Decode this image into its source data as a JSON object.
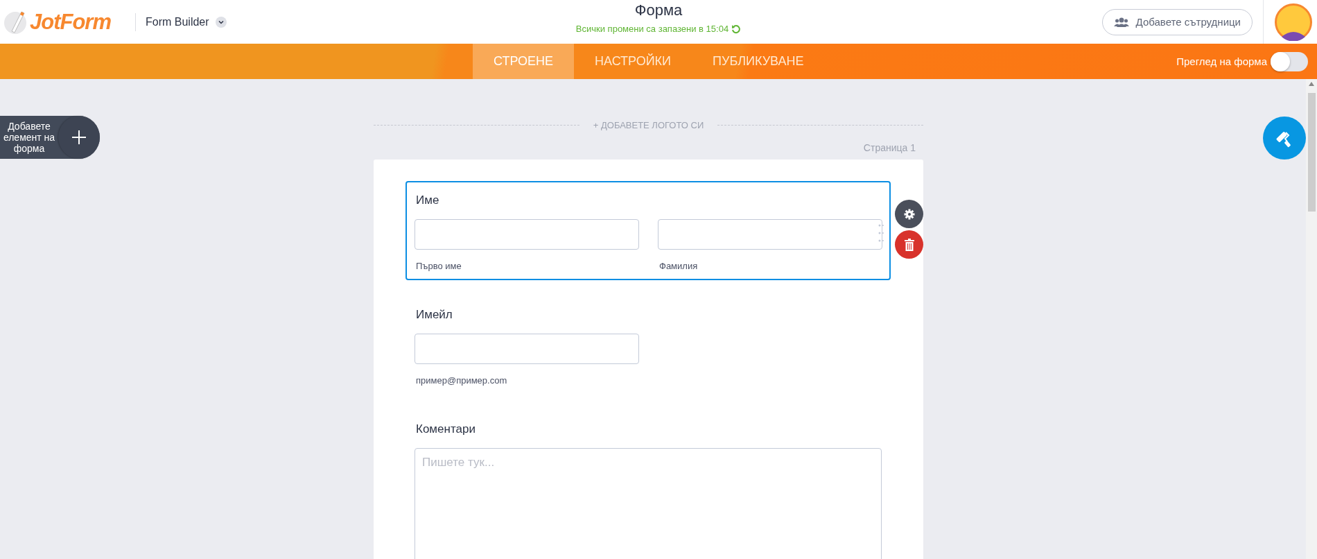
{
  "header": {
    "logo": "JotForm",
    "app_menu": "Form Builder",
    "title": "Форма",
    "save_status": "Всички промени са запазени в 15:04",
    "collaborators_button": "Добавете сътрудници"
  },
  "tabs": [
    {
      "label": "СТРОЕНЕ",
      "selected": true
    },
    {
      "label": "НАСТРОЙКИ",
      "selected": false
    },
    {
      "label": "ПУБЛИКУВАНЕ",
      "selected": false
    }
  ],
  "preview_toggle": {
    "label": "Преглед на форма",
    "on": false
  },
  "add_element_button": "Добавете елемент на форма",
  "add_logo": "+ ДОБАВЕТЕ ЛОГОТО СИ",
  "page_label": "Страница 1",
  "fields": [
    {
      "kind": "name",
      "label": "Име",
      "selected": true,
      "sublabels": [
        "Първо име",
        "Фамилия"
      ]
    },
    {
      "kind": "email",
      "label": "Имейл",
      "selected": false,
      "sublabels": [
        "пример@пример.com"
      ]
    },
    {
      "kind": "textarea",
      "label": "Коментари",
      "selected": false,
      "placeholder": "Пишете тук..."
    }
  ]
}
